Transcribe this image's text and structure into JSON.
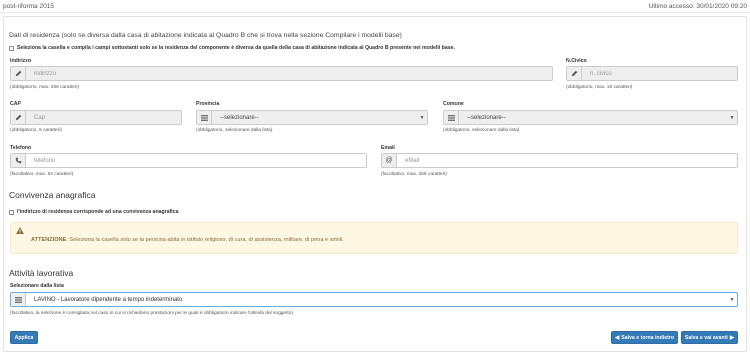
{
  "header": {
    "app_title": "post-riforma 2015",
    "last_access": "Ultimo accesso: 30/01/2020 09:20"
  },
  "residenza": {
    "intro": "Dati di residenza (solo se diversa dalla casa di abitazione indicata al Quadro B che si trova nella sezione Compilare i modelli base)",
    "checkbox_label": "Seleziona la casella e compila i campi sottostanti solo se la residenza del componente è diversa da quella della casa di abitazione indicata al Quadro B presente nei modelli base.",
    "indirizzo": {
      "label": "Indirizzo",
      "placeholder": "indirizzo",
      "help": "(obbligatorio, max. 256 caratteri)",
      "icon": "pencil-icon"
    },
    "civico": {
      "label": "N.Civico",
      "placeholder": "n. civico",
      "help": "(obbligatorio, max. 16 caratteri)",
      "icon": "pencil-icon"
    },
    "cap": {
      "label": "CAP",
      "placeholder": "Cap",
      "help": "(obbligatorio, 5 caratteri)",
      "icon": "pencil-icon"
    },
    "provincia": {
      "label": "Provincia",
      "value": "--selezionare--",
      "help": "(obbligatorio, selezionare dalla lista)",
      "icon": "list-icon"
    },
    "comune": {
      "label": "Comune",
      "value": "--selezionare--",
      "help": "(obbligatorio, selezionare dalla lista)",
      "icon": "list-icon"
    },
    "telefono": {
      "label": "Telefono",
      "placeholder": "telefono",
      "help": "(facoltativo, max. 64 caratteri)",
      "icon": "phone-icon"
    },
    "email": {
      "label": "Email",
      "placeholder": "eMail",
      "help": "(facoltativo, max. 256 caratteri)",
      "icon": "at-icon"
    }
  },
  "convivenza": {
    "title": "Convivenza anagrafica",
    "checkbox_label": "l'indirizzo di residenza corrisponde ad una convivenza anagrafica",
    "alert_strong": "ATTENZIONE",
    "alert_text": ": Seleziona la casella solo se la persona abita in istituto religioso, di cura, di assistenza, militare, di pena e simili."
  },
  "attivita": {
    "title": "Attività lavorativa",
    "label": "Selezionare dalla lista",
    "value": "LAVINO - Lavoratore dipendente a tempo indeterminato",
    "help": "(facoltativo, la selezione è consigliata nel caso in cui si richiedano prestazioni per le quali è obbligatorio indicare l'attività del soggetto)"
  },
  "buttons": {
    "applica": "Applica",
    "salva_indietro": "Salva e torna indietro",
    "salva_avanti": "Salva e vai avanti"
  },
  "colors": {
    "primary": "#337ab7",
    "warning_bg": "#fcf8e3",
    "warning_text": "#8a6d3b"
  }
}
